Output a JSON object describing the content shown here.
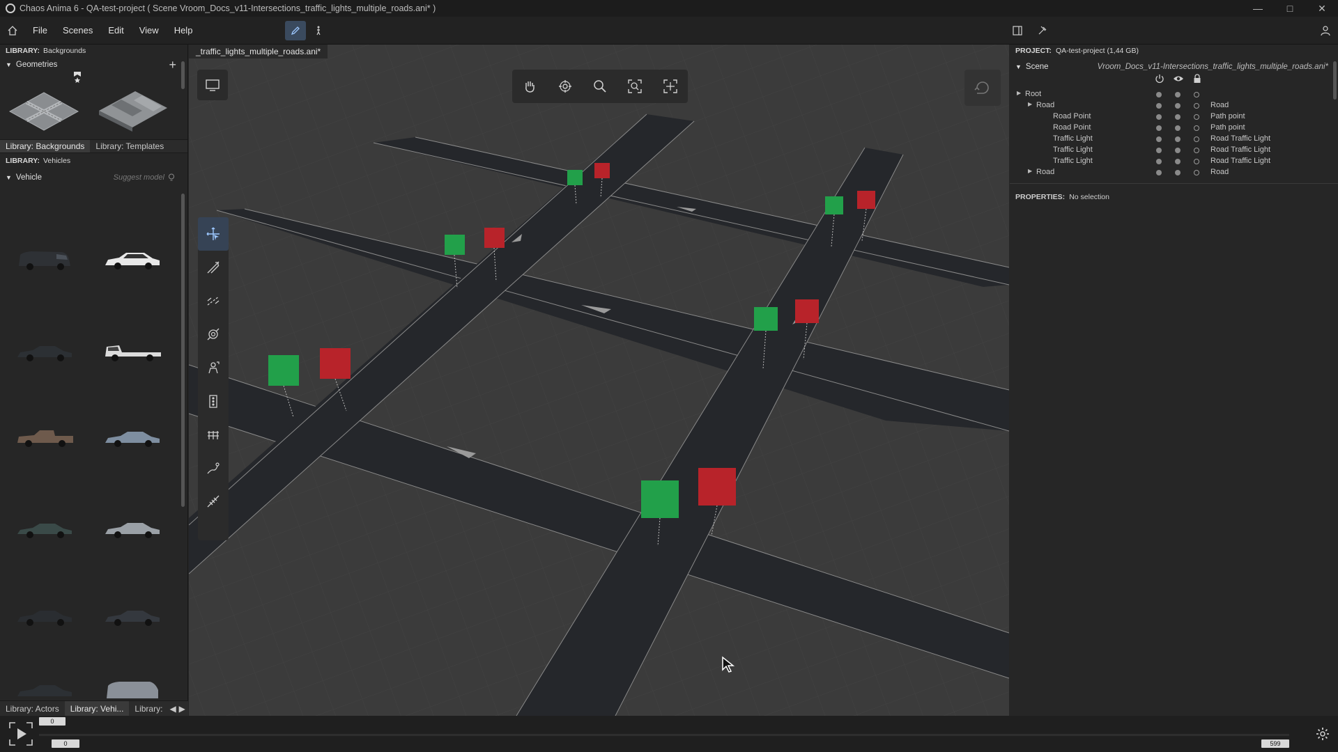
{
  "window": {
    "title": "Chaos Anima 6 -   QA-test-project ( Scene Vroom_Docs_v11-Intersections_traffic_lights_multiple_roads.ani* )",
    "controls": [
      "minimize-icon",
      "maximize-icon",
      "close-icon"
    ]
  },
  "menu": {
    "items": [
      "File",
      "Scenes",
      "Edit",
      "View",
      "Help"
    ]
  },
  "left": {
    "library_label": "LIBRARY:",
    "backgrounds_name": "Backgrounds",
    "geometries": "Geometries",
    "tabs": [
      "Library: Backgrounds",
      "Library: Templates"
    ],
    "vehicles_name": "Vehicles",
    "vehicle_section": "Vehicle",
    "suggest": "Suggest model",
    "bottom_tabs": [
      "Library: Actors",
      "Library: Vehi...",
      "Library:"
    ]
  },
  "viewport": {
    "doc_tab": "_traffic_lights_multiple_roads.ani*",
    "toolbar_icons": [
      "hand-icon",
      "orbit-icon",
      "zoom-icon",
      "focus-icon",
      "frame-all-icon"
    ],
    "tools": [
      "select-move-icon",
      "road-draw-icon",
      "lane-icon",
      "roundabout-icon",
      "actor-icon",
      "traffic-light-icon",
      "fence-icon",
      "path-icon",
      "crosswalk-icon"
    ]
  },
  "right": {
    "project_label": "PROJECT:",
    "project_name": "QA-test-project (1,44 GB)",
    "scene_label": "Scene",
    "scene_file": "Vroom_Docs_v11-Intersections_traffic_lights_multiple_roads.ani*",
    "tree": [
      {
        "name": "Root",
        "type": "",
        "indent": 0,
        "arrow": true
      },
      {
        "name": "Road",
        "type": "Road",
        "indent": 1,
        "arrow": true
      },
      {
        "name": "Road Point",
        "type": "Path point",
        "indent": 2,
        "arrow": false
      },
      {
        "name": "Road Point",
        "type": "Path point",
        "indent": 2,
        "arrow": false
      },
      {
        "name": "Traffic Light",
        "type": "Road Traffic Light",
        "indent": 2,
        "arrow": false
      },
      {
        "name": "Traffic Light",
        "type": "Road Traffic Light",
        "indent": 2,
        "arrow": false
      },
      {
        "name": "Traffic Light",
        "type": "Road Traffic Light",
        "indent": 2,
        "arrow": false
      },
      {
        "name": "Road",
        "type": "Road",
        "indent": 1,
        "arrow": true
      }
    ],
    "properties_label": "PROPERTIES:",
    "properties_value": "No selection"
  },
  "timeline": {
    "current": "0",
    "start": "0",
    "end": "599"
  },
  "colors": {
    "green_light": "#22a04a",
    "red_light": "#b8232a",
    "road": "#25272b",
    "ground": "#3b3b3b"
  }
}
